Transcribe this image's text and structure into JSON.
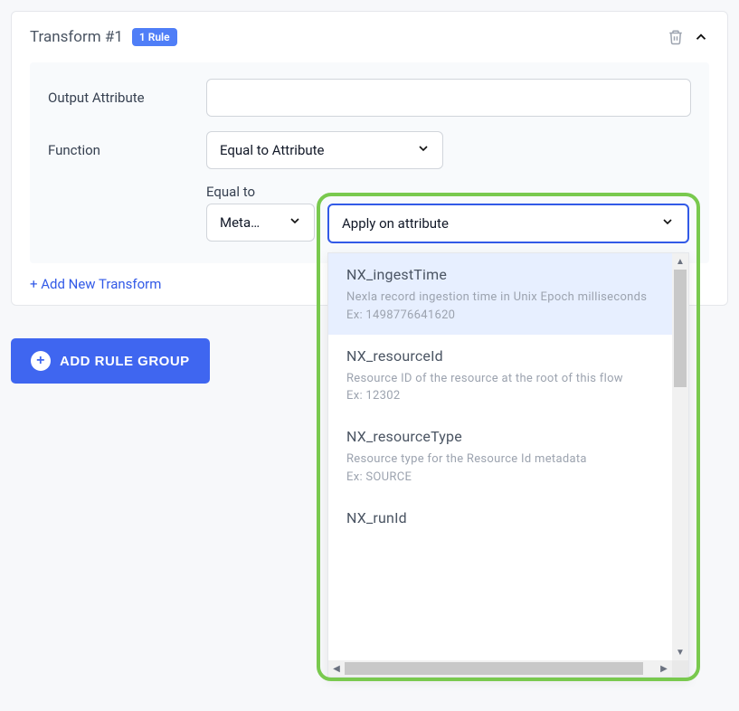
{
  "panel": {
    "title": "Transform #1",
    "rule_badge": "1 Rule"
  },
  "form": {
    "output_attribute_label": "Output Attribute",
    "output_attribute_value": "",
    "function_label": "Function",
    "function_value": "Equal to Attribute",
    "equal_to_label": "Equal to",
    "equal_to_value": "Meta…",
    "apply_on_placeholder": "Apply on attribute"
  },
  "dropdown": {
    "items": [
      {
        "name": "NX_ingestTime",
        "desc": "Nexla record ingestion time in Unix Epoch milliseconds",
        "example": "Ex: 1498776641620",
        "highlighted": true
      },
      {
        "name": "NX_resourceId",
        "desc": "Resource ID of the resource at the root of this flow",
        "example": "Ex: 12302",
        "highlighted": false
      },
      {
        "name": "NX_resourceType",
        "desc": "Resource type for the Resource Id metadata",
        "example": "Ex: SOURCE",
        "highlighted": false
      },
      {
        "name": "NX_runId",
        "desc": "",
        "example": "",
        "highlighted": false
      }
    ]
  },
  "actions": {
    "add_transform": "+ Add New Transform",
    "add_rule_group": "ADD RULE GROUP"
  }
}
